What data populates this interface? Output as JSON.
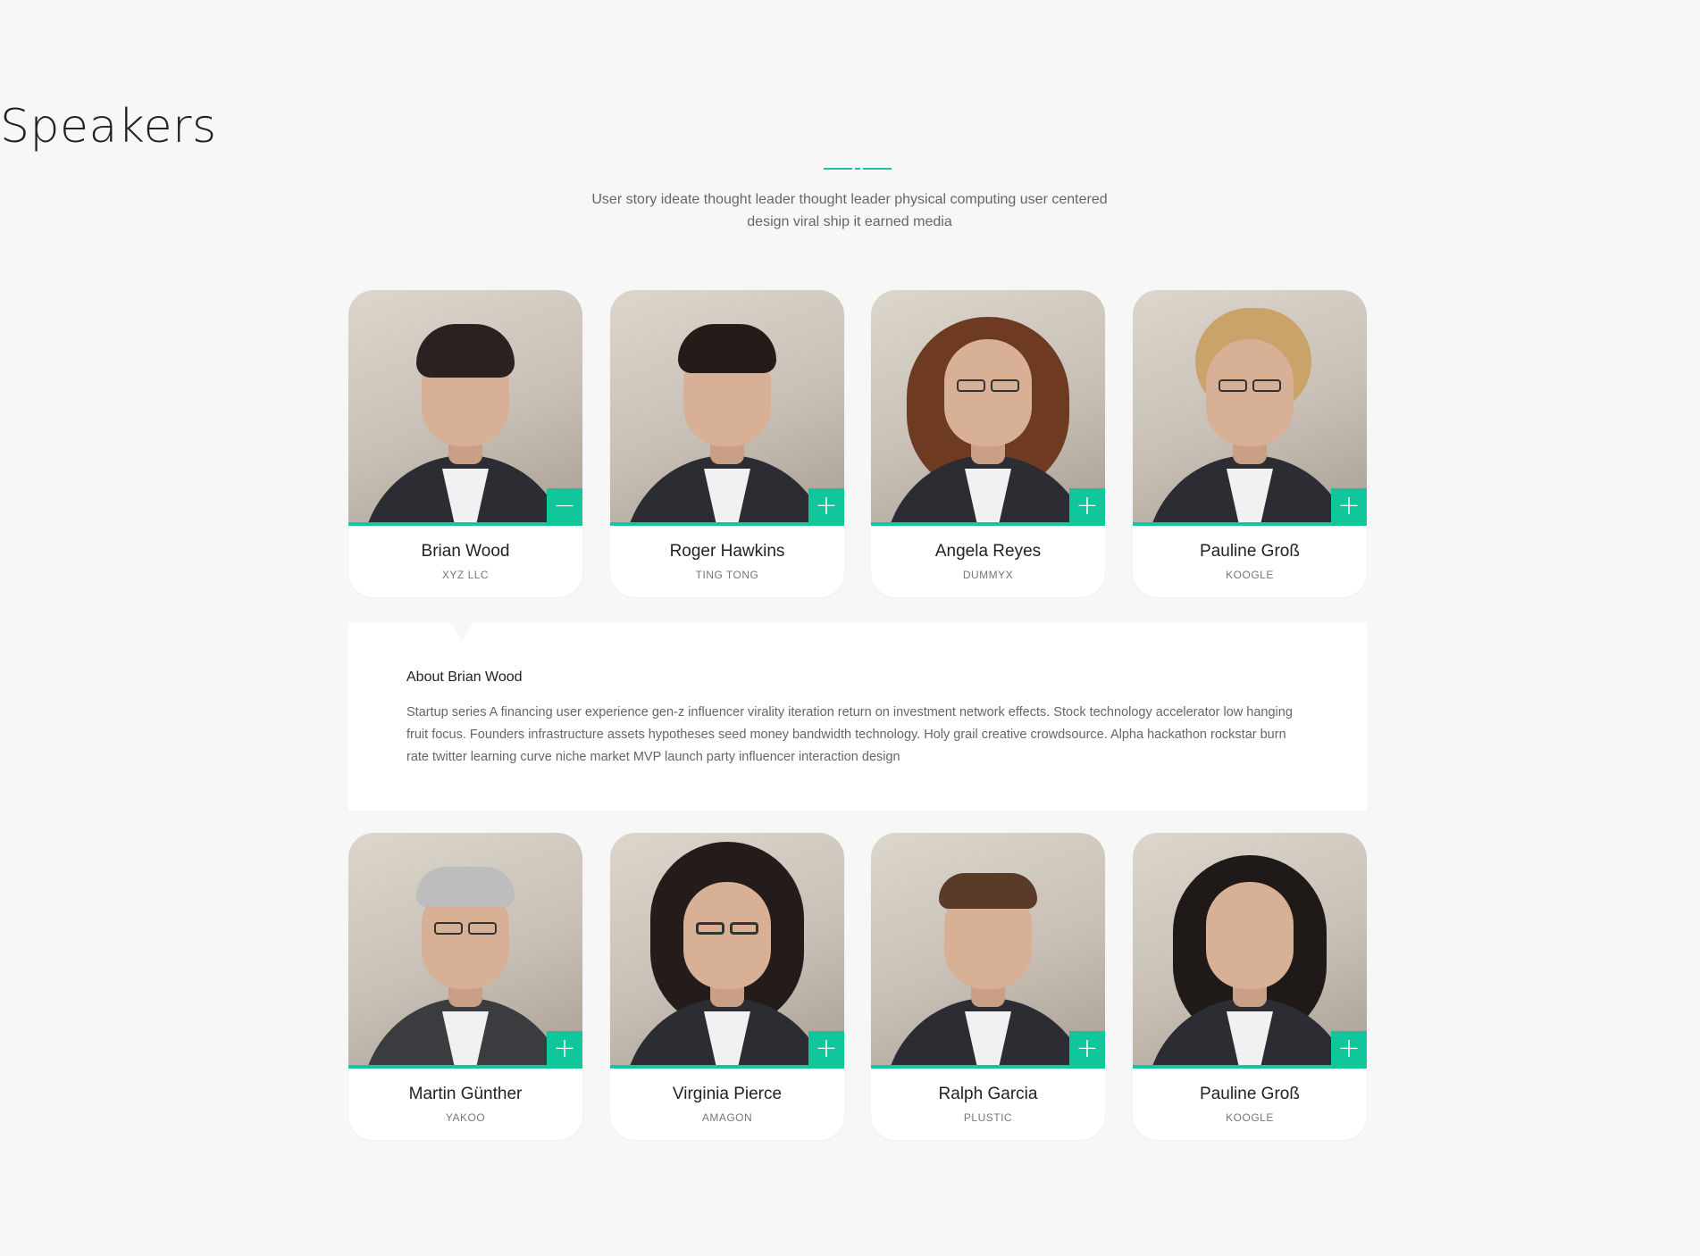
{
  "header": {
    "title": "Speakers",
    "subtitle": "User story ideate thought leader thought leader physical computing user centered design viral ship it earned media"
  },
  "speakers_row1": [
    {
      "name": "Brian Wood",
      "company": "XYZ LLC",
      "toggle": "−",
      "expanded": true
    },
    {
      "name": "Roger Hawkins",
      "company": "TING TONG",
      "toggle": "+",
      "expanded": false
    },
    {
      "name": "Angela Reyes",
      "company": "DUMMYX",
      "toggle": "+",
      "expanded": false
    },
    {
      "name": "Pauline Groß",
      "company": "KOOGLE",
      "toggle": "+",
      "expanded": false
    }
  ],
  "about": {
    "title": "About Brian Wood",
    "text": "Startup series A financing user experience gen-z influencer virality iteration return on investment network effects. Stock technology accelerator low hanging fruit focus. Founders infrastructure assets hypotheses seed money bandwidth technology. Holy grail creative crowdsource. Alpha hackathon rockstar burn rate twitter learning curve niche market MVP launch party influencer interaction design"
  },
  "speakers_row2": [
    {
      "name": "Martin Günther",
      "company": "YAKOO",
      "toggle": "+",
      "expanded": false
    },
    {
      "name": "Virginia Pierce",
      "company": "AMAGON",
      "toggle": "+",
      "expanded": false
    },
    {
      "name": "Ralph Garcia",
      "company": "PLUSTIC",
      "toggle": "+",
      "expanded": false
    },
    {
      "name": "Pauline Groß",
      "company": "KOOGLE",
      "toggle": "+",
      "expanded": false
    }
  ],
  "colors": {
    "accent": "#17c4a0",
    "toggle_bg": "#0fc79b",
    "background": "#f7f7f7"
  }
}
